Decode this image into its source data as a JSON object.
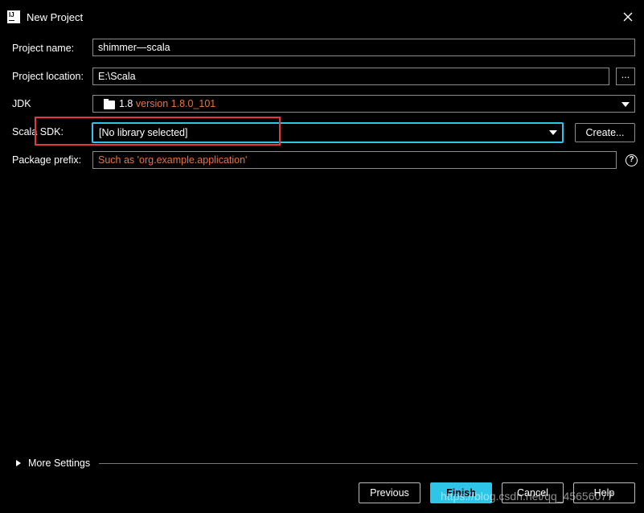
{
  "window": {
    "title": "New Project",
    "app_icon_text": "IJ"
  },
  "form": {
    "project_name": {
      "label": "Project name:",
      "value": "shimmer—scala"
    },
    "project_location": {
      "label": "Project location:",
      "value": "E:\\Scala",
      "browse_label": "..."
    },
    "jdk": {
      "label": "JDK",
      "value_prefix": "1.8",
      "value_version": "version 1.8.0_101"
    },
    "scala_sdk": {
      "label": "Scala SDK:",
      "value": "[No library selected]",
      "create_label": "Create..."
    },
    "package_prefix": {
      "label": "Package prefix:",
      "placeholder": "Such as 'org.example.application'",
      "help_glyph": "?"
    }
  },
  "more_settings": {
    "label": "More Settings"
  },
  "footer": {
    "previous_label": "Previous",
    "finish_label": "Finish",
    "cancel_label": "Cancel",
    "help_label": "Help"
  },
  "watermark": "https://blog.csdn.net/qq_45656077",
  "colors": {
    "background": "#000000",
    "accent": "#2ec6e8",
    "highlight_box": "#e03a3a",
    "version_text": "#e8733a"
  }
}
